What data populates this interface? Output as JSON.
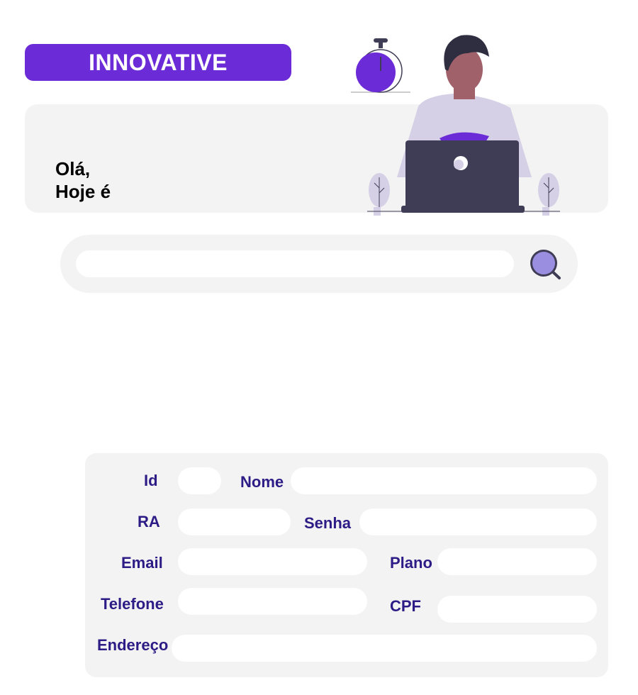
{
  "header": {
    "brand": "INNOVATIVE"
  },
  "hero": {
    "greeting_line1": "Olá,",
    "greeting_line2": "Hoje é"
  },
  "search": {
    "value": "",
    "placeholder": ""
  },
  "form": {
    "id_label": "Id",
    "id_value": "",
    "nome_label": "Nome",
    "nome_value": "",
    "ra_label": "RA",
    "ra_value": "",
    "senha_label": "Senha",
    "senha_value": "",
    "email_label": "Email",
    "email_value": "",
    "plano_label": "Plano",
    "plano_value": "",
    "telefone_label": "Telefone",
    "telefone_value": "",
    "cpf_label": "CPF",
    "cpf_value": "",
    "endereco_label": "Endereço",
    "endereco_value": ""
  },
  "colors": {
    "accent": "#6b2bd6",
    "label": "#2d1b86",
    "panel": "#f3f3f3",
    "search_glass": "#9a8ee0"
  }
}
